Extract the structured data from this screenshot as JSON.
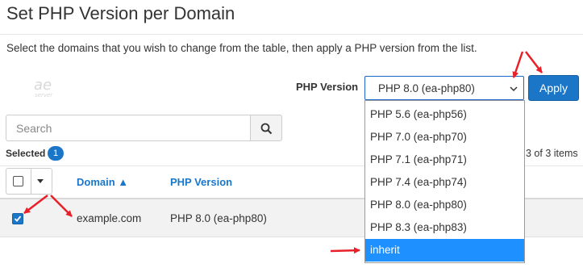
{
  "page": {
    "title": "Set PHP Version per Domain",
    "instructions": "Select the domains that you wish to change from the table, then apply a PHP version from the list."
  },
  "toolbar": {
    "php_version_label": "PHP Version",
    "selected_value": "PHP 8.0 (ea-php80)",
    "apply_label": "Apply"
  },
  "dropdown": {
    "options": [
      "PHP 5.6 (ea-php56)",
      "PHP 7.0 (ea-php70)",
      "PHP 7.1 (ea-php71)",
      "PHP 7.4 (ea-php74)",
      "PHP 8.0 (ea-php80)",
      "PHP 8.3 (ea-php83)",
      "inherit"
    ],
    "highlighted": "inherit"
  },
  "search": {
    "placeholder": "Search"
  },
  "selection": {
    "label": "Selected",
    "count": "1"
  },
  "pagination": {
    "item_count": "3 of 3 items"
  },
  "table": {
    "columns": [
      "Domain ▲",
      "PHP Version"
    ],
    "rows": [
      {
        "checked": true,
        "domain": "example.com",
        "php_version": "PHP 8.0 (ea-php80)"
      }
    ]
  },
  "colors": {
    "accent": "#1b76c8",
    "highlight": "#1e90ff",
    "annotation": "#e8202a"
  },
  "icons": [
    "search-icon",
    "chevron-down-icon",
    "caret-down-icon",
    "check-icon",
    "logo"
  ]
}
